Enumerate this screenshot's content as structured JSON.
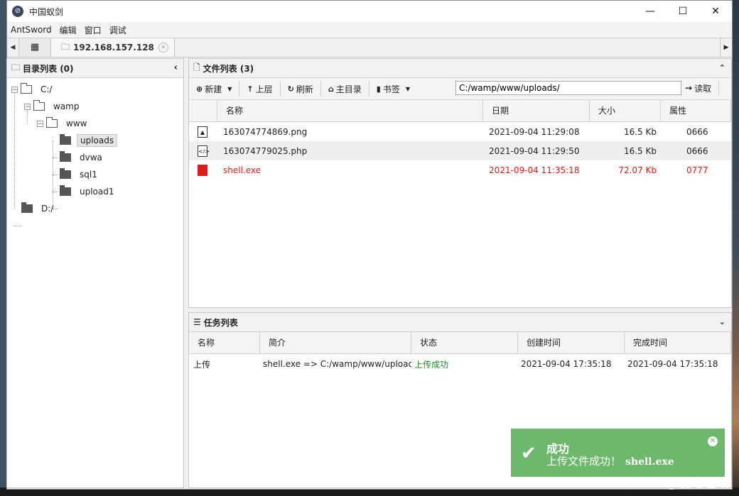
{
  "window": {
    "title": "中国蚁剑",
    "minimize": "—",
    "maximize": "☐",
    "close": "✕"
  },
  "menu": [
    "AntSword",
    "编辑",
    "窗口",
    "调试"
  ],
  "tabs": {
    "grid_icon": "grid-icon",
    "host": "192.168.157.128"
  },
  "dir_panel": {
    "title": "目录列表 (0)"
  },
  "tree": [
    {
      "label": "C:/",
      "toggle": "−"
    },
    {
      "label": "wamp",
      "toggle": "−"
    },
    {
      "label": "www",
      "toggle": "−"
    },
    {
      "label": "uploads"
    },
    {
      "label": "dvwa"
    },
    {
      "label": "sql1"
    },
    {
      "label": "upload1"
    },
    {
      "label": "D:/"
    }
  ],
  "file_panel": {
    "title": "文件列表 (3)"
  },
  "toolbar": {
    "new": "新建",
    "up": "上层",
    "refresh": "刷新",
    "home": "主目录",
    "bookmark": "书签",
    "path": "C:/wamp/www/uploads/",
    "read": "读取"
  },
  "file_columns": [
    "名称",
    "日期",
    "大小",
    "属性"
  ],
  "files": [
    {
      "name": "163074774869.png",
      "date": "2021-09-04 11:29:08",
      "size": "16.5 Kb",
      "perm": "0666",
      "icon": "image-file-icon"
    },
    {
      "name": "163074779025.php",
      "date": "2021-09-04 11:29:50",
      "size": "16.5 Kb",
      "perm": "0666",
      "icon": "code-file-icon"
    },
    {
      "name": "shell.exe",
      "date": "2021-09-04 11:35:18",
      "size": "72.07 Kb",
      "perm": "0777",
      "icon": "exe-file-icon"
    }
  ],
  "task_panel": {
    "title": "任务列表"
  },
  "task_columns": [
    "名称",
    "简介",
    "状态",
    "创建时间",
    "完成时间"
  ],
  "tasks": [
    {
      "name": "上传",
      "desc": "shell.exe => C:/wamp/www/uploads/",
      "status": "上传成功",
      "created": "2021-09-04 17:35:18",
      "finished": "2021-09-04 17:35:18"
    }
  ],
  "toast": {
    "title": "成功",
    "message": "上传文件成功！",
    "file": "shell.exe"
  },
  "watermark": "CSDN @漫路在线",
  "colors": {
    "danger": "#e01b1b",
    "success": "#1e8a1e",
    "toast_bg": "#6db86d"
  }
}
